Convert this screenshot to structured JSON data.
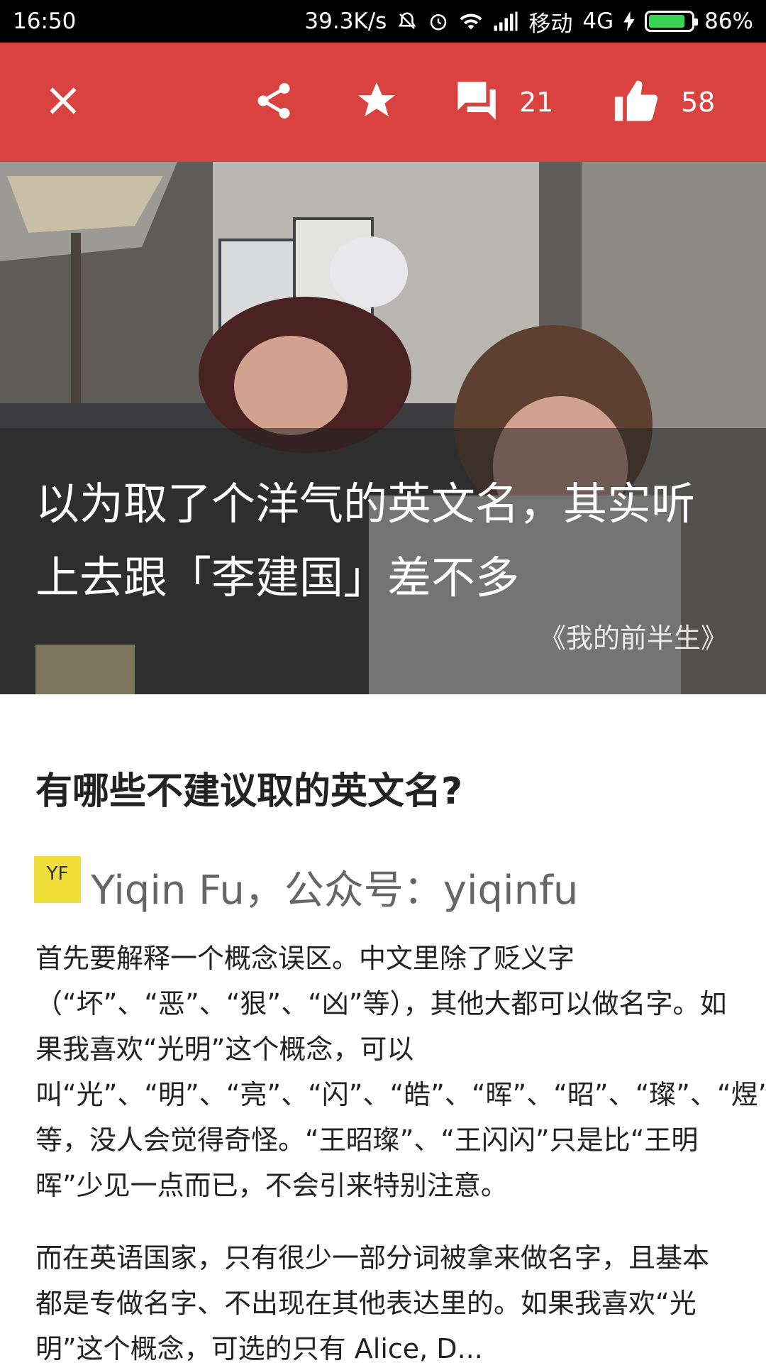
{
  "status_bar": {
    "time": "16:50",
    "net_speed": "39.3K/s",
    "carrier": "移动",
    "network": "4G",
    "battery_percent": "86%",
    "battery_level": 0.86,
    "battery_color": "#39d353"
  },
  "toolbar": {
    "background_color": "#d9423f",
    "comment_count": "21",
    "like_count": "58",
    "icons": [
      "close-icon",
      "share-icon",
      "star-icon",
      "comment-icon",
      "thumbs-up-icon"
    ]
  },
  "hero": {
    "title": "以为取了个洋气的英文名，其实听上去跟「李建国」差不多",
    "source": "《我的前半生》"
  },
  "article": {
    "question_title": "有哪些不建议取的英文名?",
    "author_avatar_text": "YF",
    "author_name": "Yiqin Fu，公众号：yiqinfu",
    "paragraph1": "首先要解释一个概念误区。中文里除了贬义字（“坏”、“恶”、“狠”、“凶”等），其他大都可以做名字。如果我喜欢“光明”这个概念，可以叫“光”、“明”、“亮”、“闪”、“皓”、“晖”、“昭”、“璨”、“煜”等等，没人会觉得奇怪。“王昭璨”、“王闪闪”只是比“王明晖”少见一点而已，不会引来特别注意。",
    "paragraph2": "而在英语国家，只有很少一部分词被拿来做名字，且基本都是专做名字、不出现在其他表达里的。如果我喜欢“光明”这个概念，可选的只有 Alice, D..."
  }
}
